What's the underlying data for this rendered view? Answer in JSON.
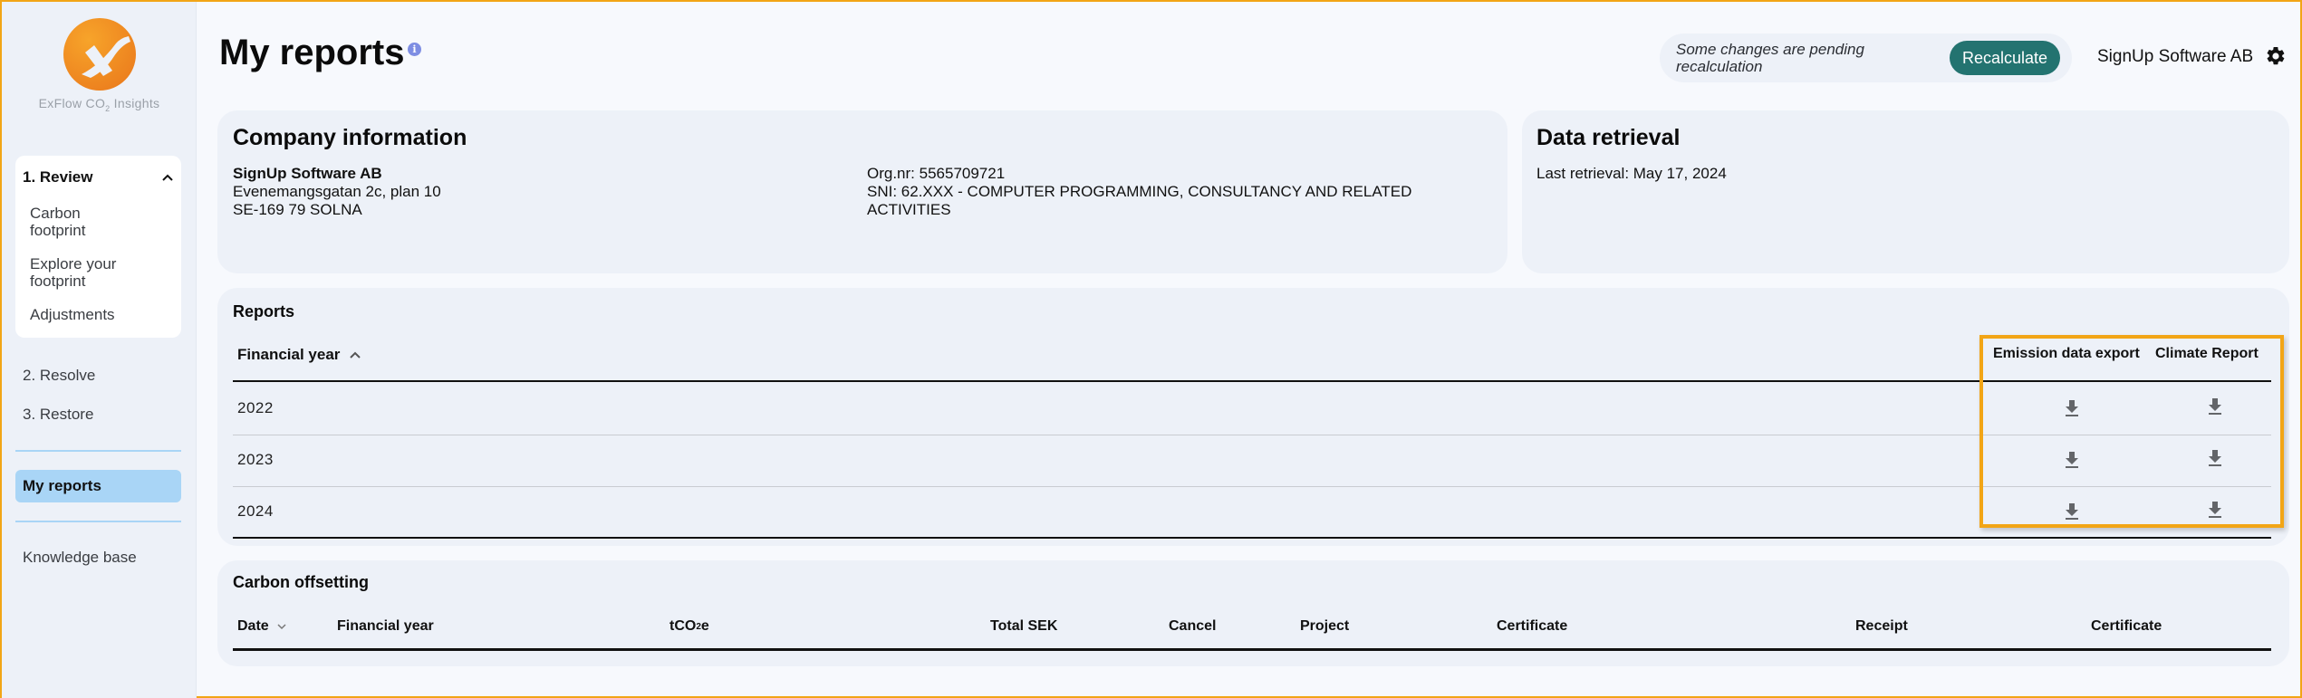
{
  "app": {
    "logo_text": "ExFlow CO",
    "logo_sub": "2",
    "logo_suffix": " Insights"
  },
  "sidebar": {
    "group": {
      "label": "1. Review",
      "items": [
        {
          "label": "Carbon footprint"
        },
        {
          "label": "Explore your footprint"
        },
        {
          "label": "Adjustments"
        }
      ]
    },
    "items": [
      {
        "label": "2. Resolve"
      },
      {
        "label": "3. Restore"
      }
    ],
    "active": {
      "label": "My reports"
    },
    "knowledge": {
      "label": "Knowledge base"
    }
  },
  "header": {
    "title": "My reports",
    "info_icon": "i",
    "pending_text": "Some changes are pending recalculation",
    "recalculate_label": "Recalculate",
    "company_name": "SignUp Software AB"
  },
  "company_info": {
    "title": "Company information",
    "name": "SignUp Software AB",
    "address_line1": "Evenemangsgatan 2c, plan 10",
    "address_line2": "SE-169 79 SOLNA",
    "org_nr": "Org.nr: 5565709721",
    "sni": "SNI: 62.XXX - COMPUTER PROGRAMMING, CONSULTANCY AND RELATED ACTIVITIES"
  },
  "data_retrieval": {
    "title": "Data retrieval",
    "last_retrieval": "Last retrieval: May 17, 2024"
  },
  "reports": {
    "title": "Reports",
    "columns": {
      "financial_year": "Financial year",
      "emission_export": "Emission data export",
      "climate_report": "Climate Report"
    },
    "rows": [
      {
        "year": "2022"
      },
      {
        "year": "2023"
      },
      {
        "year": "2024"
      }
    ]
  },
  "carbon_offsetting": {
    "title": "Carbon offsetting",
    "columns": {
      "date": "Date",
      "financial_year": "Financial year",
      "tco2e_prefix": "tCO",
      "tco2e_sub": "2",
      "tco2e_suffix": "e",
      "total_sek": "Total SEK",
      "cancel": "Cancel",
      "project": "Project",
      "certificate": "Certificate",
      "receipt": "Receipt",
      "certificate2": "Certificate"
    }
  },
  "colors": {
    "accent_teal": "#237370",
    "highlight_orange": "#f2a516",
    "nav_active": "#a9d5f6",
    "logo_orange": "#ec7f1e",
    "info_icon": "#7e8ee3"
  }
}
